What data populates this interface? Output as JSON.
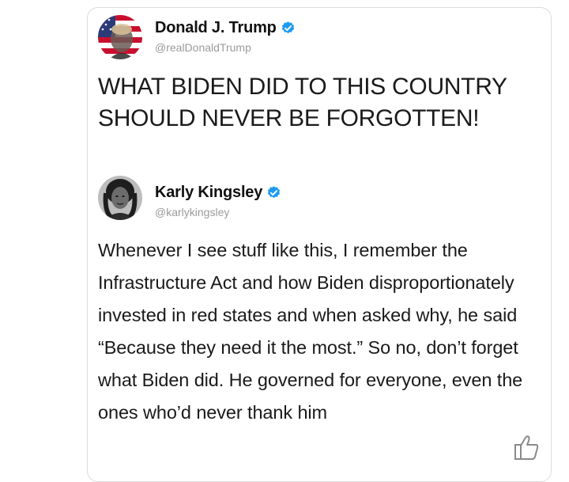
{
  "main_tweet": {
    "display_name": "Donald J. Trump",
    "handle": "@realDonaldTrump",
    "verified_icon": "verified-badge-icon",
    "text": "WHAT BIDEN DID TO THIS COUNTRY SHOULD NEVER BE FORGOTTEN!"
  },
  "reply_tweet": {
    "display_name": "Karly Kingsley",
    "handle": "@karlykingsley",
    "verified_icon": "verified-badge-icon",
    "text": "Whenever I see stuff like this, I remember the Infrastructure Act and how Biden disproportionately invested in red states and when asked why, he said “Because they need it the most.” So no, don’t forget what Biden did. He governed for everyone, even the ones who’d never thank him"
  },
  "colors": {
    "verified_blue": "#1d9bf0",
    "flag_red": "#c8102e",
    "flag_blue": "#2b3a78"
  },
  "icons": {
    "thumb": "thumbs-up-icon"
  }
}
